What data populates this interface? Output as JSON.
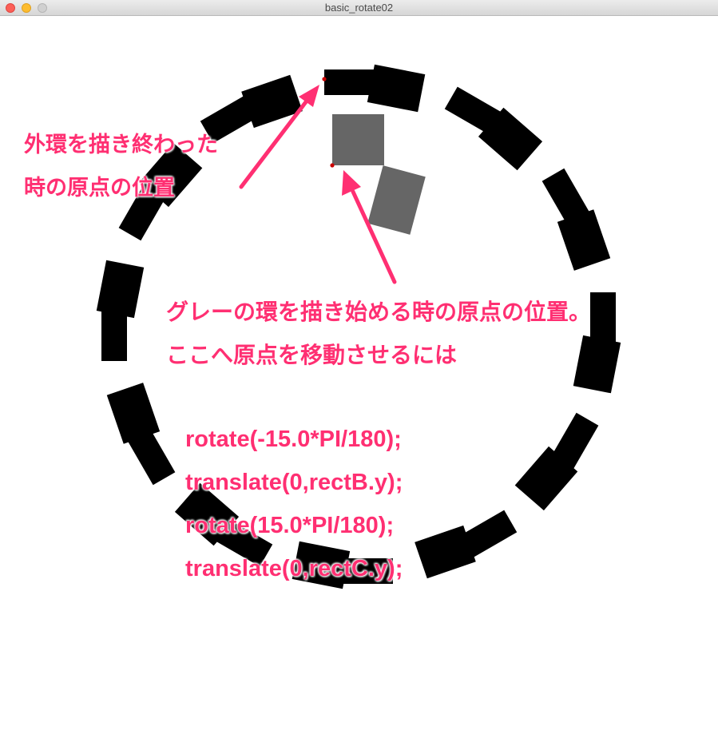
{
  "window": {
    "title": "basic_rotate02"
  },
  "colors": {
    "outer_ring": "#000000",
    "inner_rect": "#666666",
    "annotation": "#ff2f72",
    "origin_dot": "#cc0000"
  },
  "annotations": {
    "outer_ring_end": {
      "lines": [
        "外環を描き終わった",
        "時の原点の位置"
      ]
    },
    "gray_ring_start": {
      "lines": [
        "グレーの環を描き始める時の原点の位置。",
        "ここへ原点を移動させるには"
      ]
    },
    "code": {
      "lines": [
        "rotate(-15.0*PI/180);",
        "translate(0,rectB.y);",
        "rotate(15.0*PI/180);",
        "translate(0,rectC.y);"
      ]
    }
  }
}
